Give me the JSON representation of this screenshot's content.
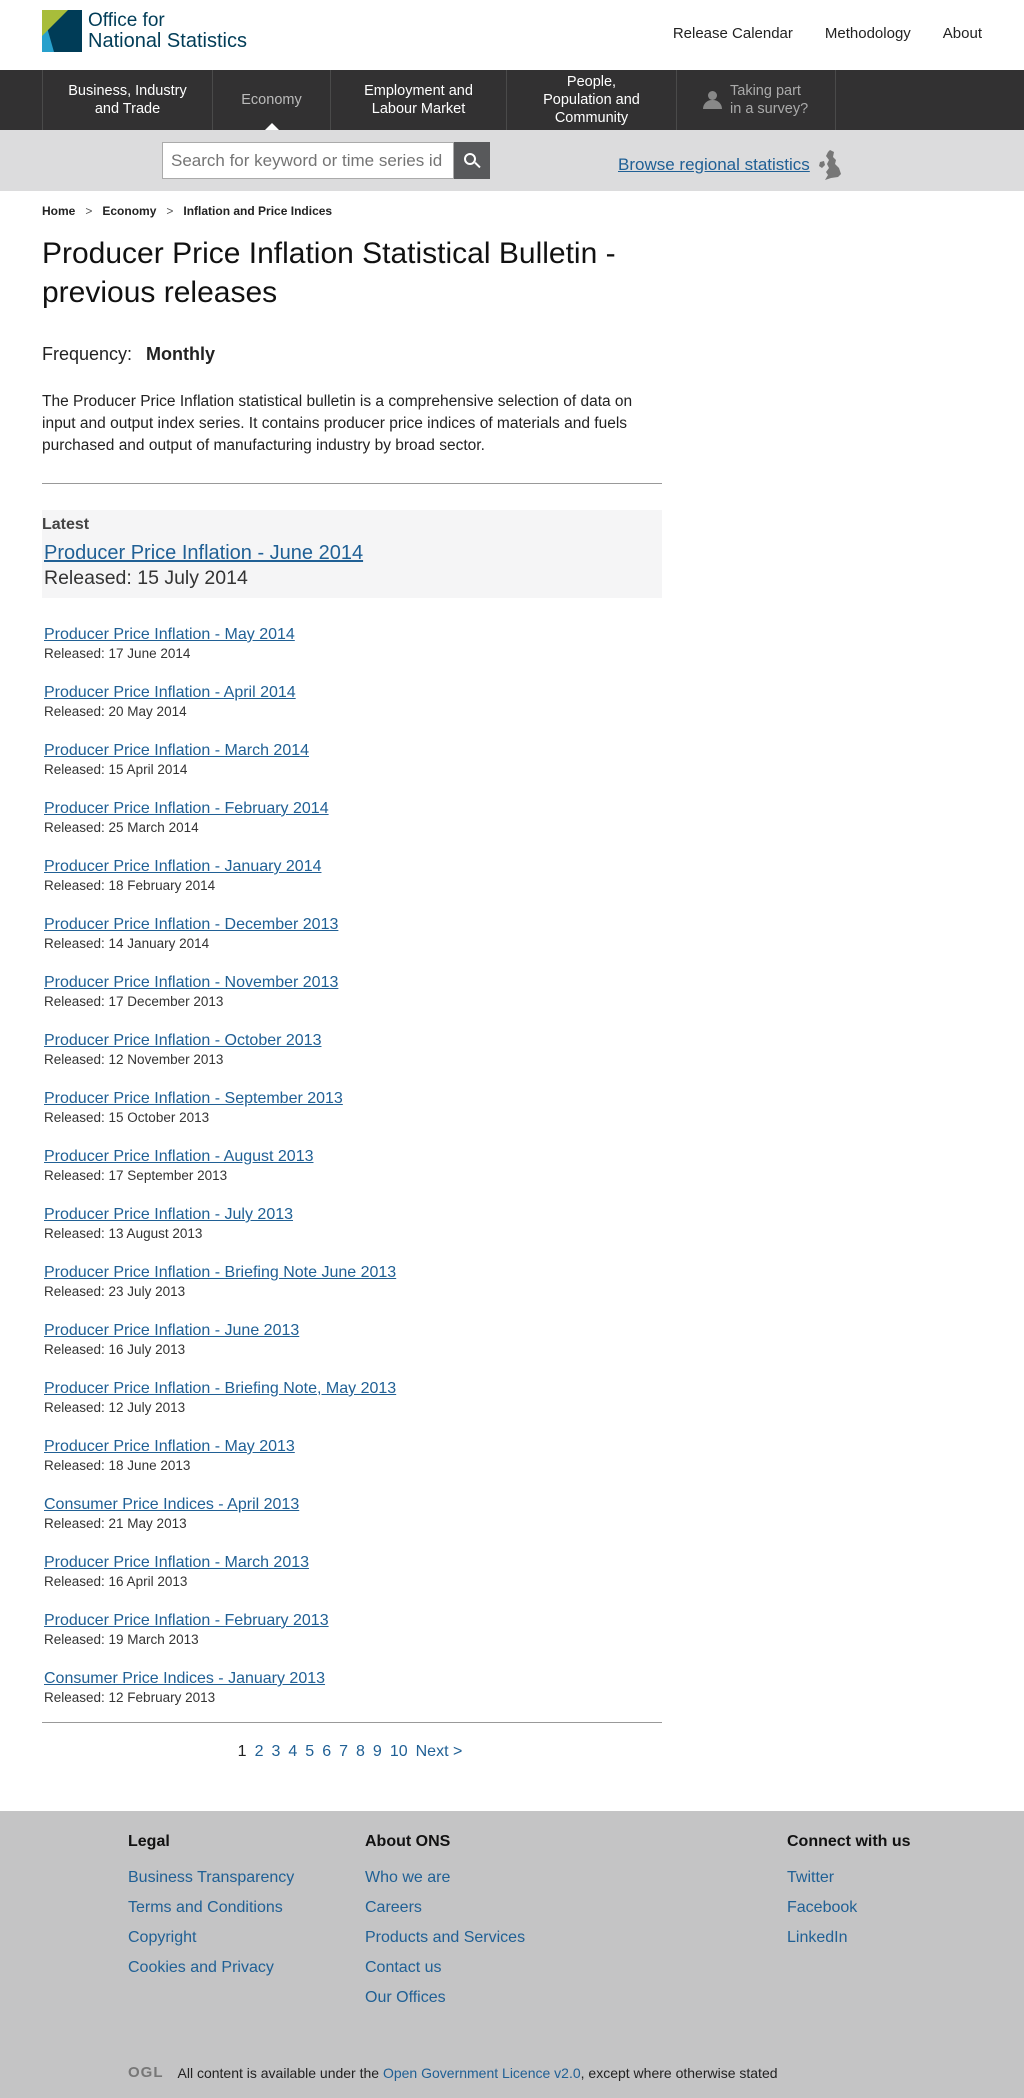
{
  "header": {
    "logo_line1": "Office for",
    "logo_line2": "National Statistics",
    "links": [
      "Release Calendar",
      "Methodology",
      "About"
    ]
  },
  "nav": {
    "items": [
      {
        "label": "Business, Industry and Trade"
      },
      {
        "label": "Economy"
      },
      {
        "label": "Employment and Labour Market"
      },
      {
        "label": "People, Population and Community"
      }
    ],
    "survey_label": "Taking part in a survey?"
  },
  "search": {
    "placeholder": "Search for keyword or time series id",
    "regional_link": "Browse regional statistics"
  },
  "breadcrumb": [
    "Home",
    "Economy",
    "Inflation and Price Indices"
  ],
  "page": {
    "title": "Producer Price Inflation Statistical Bulletin - previous releases",
    "frequency_label": "Frequency:",
    "frequency_value": "Monthly",
    "summary": "The Producer Price Inflation statistical bulletin is a comprehensive selection of data on input and output index series. It contains producer price indices of materials and fuels purchased and output of manufacturing industry by broad sector."
  },
  "latest": {
    "label": "Latest",
    "title": "Producer Price Inflation - June 2014",
    "released": "Released: 15 July 2014"
  },
  "releases": [
    {
      "title": "Producer Price Inflation - May 2014",
      "released": "Released: 17 June 2014"
    },
    {
      "title": "Producer Price Inflation - April 2014",
      "released": "Released: 20 May 2014"
    },
    {
      "title": "Producer Price Inflation - March 2014",
      "released": "Released: 15 April 2014"
    },
    {
      "title": "Producer Price Inflation - February 2014",
      "released": "Released: 25 March 2014"
    },
    {
      "title": "Producer Price Inflation - January 2014",
      "released": "Released: 18 February 2014"
    },
    {
      "title": "Producer Price Inflation - December 2013",
      "released": "Released: 14 January 2014"
    },
    {
      "title": "Producer Price Inflation - November 2013",
      "released": "Released: 17 December 2013"
    },
    {
      "title": "Producer Price Inflation - October 2013",
      "released": "Released: 12 November 2013"
    },
    {
      "title": "Producer Price Inflation - September 2013",
      "released": "Released: 15 October 2013"
    },
    {
      "title": "Producer Price Inflation - August 2013",
      "released": "Released: 17 September 2013"
    },
    {
      "title": "Producer Price Inflation - July 2013",
      "released": "Released: 13 August 2013"
    },
    {
      "title": "Producer Price Inflation - Briefing Note June 2013",
      "released": "Released: 23 July 2013"
    },
    {
      "title": "Producer Price Inflation - June 2013",
      "released": "Released: 16 July 2013"
    },
    {
      "title": "Producer Price Inflation - Briefing Note, May 2013",
      "released": "Released: 12 July 2013"
    },
    {
      "title": "Producer Price Inflation - May 2013",
      "released": "Released: 18 June 2013"
    },
    {
      "title": "Consumer Price Indices - April 2013",
      "released": "Released: 21 May 2013"
    },
    {
      "title": "Producer Price Inflation - March 2013",
      "released": "Released: 16 April 2013"
    },
    {
      "title": "Producer Price Inflation - February 2013",
      "released": "Released: 19 March 2013"
    },
    {
      "title": "Consumer Price Indices - January 2013",
      "released": "Released: 12 February 2013"
    }
  ],
  "pager": {
    "current": "1",
    "pages": [
      "2",
      "3",
      "4",
      "5",
      "6",
      "7",
      "8",
      "9",
      "10"
    ],
    "next": "Next >"
  },
  "footer": {
    "legal": {
      "heading": "Legal",
      "links": [
        "Business Transparency",
        "Terms and Conditions",
        "Copyright",
        "Cookies and Privacy"
      ]
    },
    "about": {
      "heading": "About ONS",
      "links": [
        "Who we are",
        "Careers",
        "Products and Services",
        "Contact us",
        "Our Offices"
      ]
    },
    "connect": {
      "heading": "Connect with us",
      "links": [
        "Twitter",
        "Facebook",
        "LinkedIn"
      ]
    },
    "licence_logo": "OGL",
    "licence_pre": "All content is available under the ",
    "licence_link": "Open Government Licence v2.0",
    "licence_post": ", except where otherwise stated"
  },
  "colors": {
    "link": "#206095",
    "nav_bg": "#323132",
    "search_bg": "#dcdcdd",
    "footer_bg": "#c4c4c5"
  }
}
